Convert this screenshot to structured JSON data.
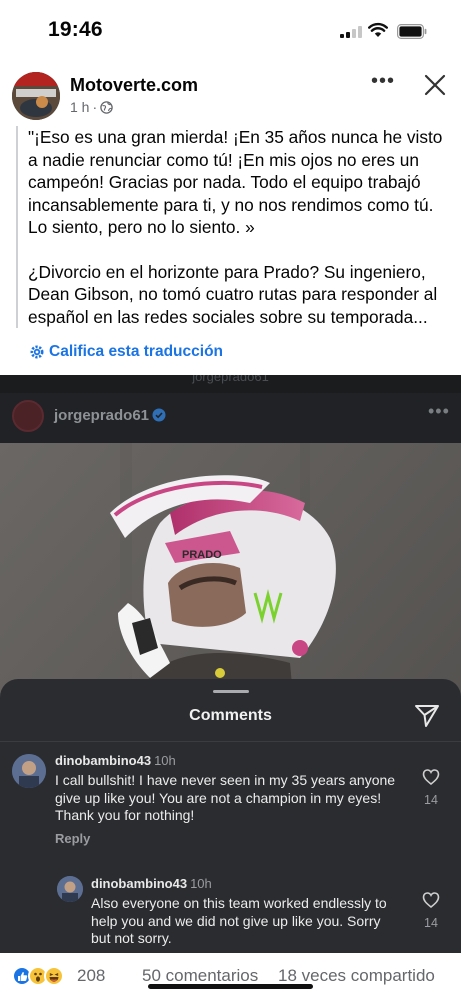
{
  "status_bar": {
    "time": "19:46"
  },
  "post": {
    "page_name": "Motoverte.com",
    "time_ago": "1 h",
    "paragraphs": [
      "\"¡Eso es una gran mierda! ¡En 35 años nunca he visto a nadie renunciar como tú! ¡En mis ojos no eres un campeón! Gracias por nada. Todo el equipo trabajó incansablemente para ti, y no nos rendimos como tú. Lo siento, pero no lo siento. »",
      "¿Divorcio en el horizonte para Prado? Su ingeniero, Dean Gibson, no tomó cuatro rutas para responder al español en las redes sociales sobre su temporada..."
    ],
    "rate_translation": "Califica esta traducción"
  },
  "image": {
    "cut_caption": "jorgeprado61",
    "instagram_user": "jorgeprado61",
    "helmet_text": "PRADO",
    "comments_sheet": {
      "title": "Comments",
      "comments": [
        {
          "user": "dinobambino43",
          "time": "10h",
          "text": "I call bullshit! I have never seen in my 35 years anyone give up like you! You are not a champion in my eyes! Thank you for nothing!",
          "reply": "Reply",
          "likes": "14"
        },
        {
          "user": "dinobambino43",
          "time": "10h",
          "text": "Also everyone on this team worked endlessly to help you and we did not give up like you. Sorry but not sorry.",
          "likes": "14"
        }
      ]
    }
  },
  "footer": {
    "reaction_count": "208",
    "comments": "50 comentarios",
    "shares": "18 veces compartido"
  },
  "colors": {
    "link_blue": "#1b74e4",
    "sheet_bg": "#2a2c2f",
    "secondary_text": "#65676b"
  }
}
